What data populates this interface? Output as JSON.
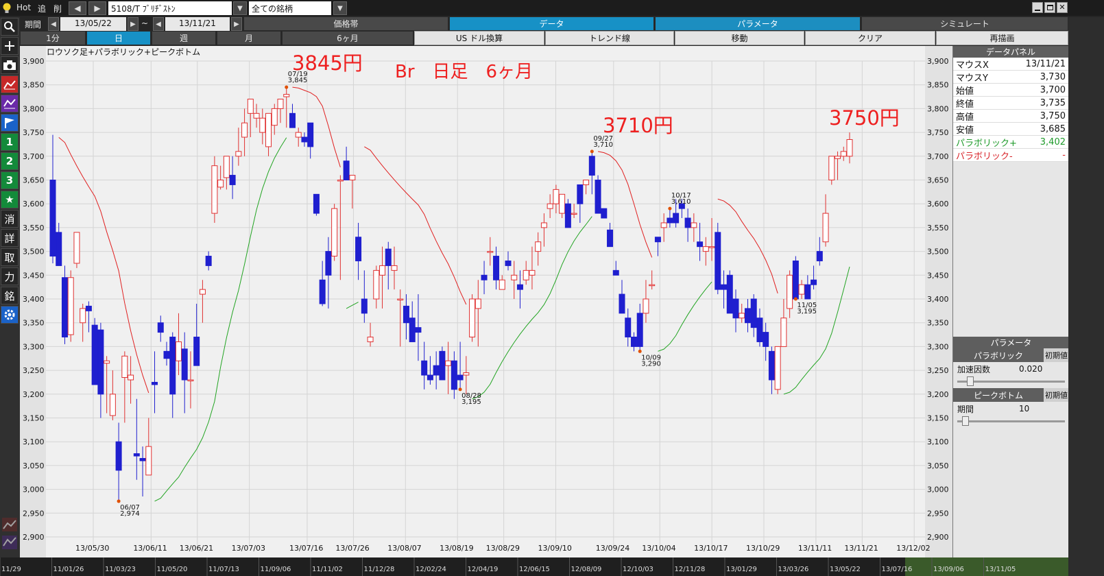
{
  "toolbar": {
    "hot": "Hot",
    "add": "追",
    "del": "削",
    "prev": "◀",
    "next": "▶",
    "symbol": "5108/T ﾌﾞﾘﾁﾞｽﾄﾝ",
    "dd": "▼",
    "group": "全ての銘柄"
  },
  "row2": {
    "period_label": "期間",
    "from": "13/05/22",
    "tilde": "~",
    "to": "13/11/21",
    "tabs": [
      "価格帯",
      "データ",
      "パラメータ",
      "シミュレート"
    ]
  },
  "row3": {
    "intervals": [
      "1分",
      "日",
      "週",
      "月",
      "6ヶ月"
    ],
    "tools": [
      "US ドル換算",
      "トレンド線",
      "移動",
      "クリア",
      "再描画"
    ]
  },
  "sidebar": {
    "g1": "1",
    "g2": "2",
    "g3": "3",
    "star": "★",
    "k1": "消",
    "k2": "詳",
    "k3": "取",
    "k4": "力",
    "k5": "銘"
  },
  "chart_data": {
    "type": "candlestick",
    "title": "ロウソク足+パラボリック+ピークボトム",
    "annotations": {
      "a1": "3845円",
      "a2": "Br　日足　6ヶ月",
      "a3": "3710円",
      "a4": "3750円"
    },
    "ylim": [
      2900,
      3900
    ],
    "y_ticks": [
      "3,900",
      "3,850",
      "3,800",
      "3,750",
      "3,700",
      "3,650",
      "3,600",
      "3,550",
      "3,500",
      "3,450",
      "3,400",
      "3,350",
      "3,300",
      "3,250",
      "3,200",
      "3,150",
      "3,100",
      "3,050",
      "3,000",
      "2,950",
      "2,900"
    ],
    "x_ticks": [
      "13/05/30",
      "13/06/11",
      "13/06/21",
      "13/07/03",
      "13/07/16",
      "13/07/26",
      "13/08/07",
      "13/08/19",
      "13/08/29",
      "13/09/10",
      "13/09/24",
      "13/10/04",
      "13/10/17",
      "13/10/29",
      "13/11/11",
      "13/11/21",
      "13/12/02"
    ],
    "peaks": [
      {
        "date": "07/19",
        "value": "3,845"
      },
      {
        "date": "06/07",
        "value": "2,974"
      },
      {
        "date": "08/28",
        "value": "3,195"
      },
      {
        "date": "09/27",
        "value": "3,710"
      },
      {
        "date": "10/09",
        "value": "3,290"
      },
      {
        "date": "10/17",
        "value": "3,610"
      },
      {
        "date": "11/05",
        "value": "3,195"
      }
    ],
    "candles": [
      [
        3650,
        3745,
        3475,
        3490
      ],
      [
        3540,
        3560,
        3470,
        3470
      ],
      [
        3445,
        3470,
        3305,
        3320
      ],
      [
        3325,
        3460,
        3310,
        3445
      ],
      [
        3475,
        3530,
        3465,
        3540
      ],
      [
        3350,
        3390,
        3310,
        3380
      ],
      [
        3385,
        3395,
        3330,
        3375
      ],
      [
        3345,
        3360,
        3220,
        3220
      ],
      [
        3335,
        3350,
        3150,
        3200
      ],
      [
        3265,
        3280,
        3160,
        3270
      ],
      [
        3155,
        3250,
        3145,
        3200
      ],
      [
        3100,
        3140,
        2975,
        3040
      ],
      [
        3235,
        3290,
        3140,
        3280
      ],
      [
        3230,
        3280,
        3180,
        3240
      ],
      [
        3075,
        3190,
        3020,
        3070
      ],
      [
        3065,
        3090,
        2985,
        3060
      ],
      [
        3030,
        3150,
        3030,
        3090
      ],
      [
        3225,
        3290,
        3160,
        3220
      ],
      [
        3350,
        3365,
        3310,
        3330
      ],
      [
        3290,
        3310,
        3260,
        3275
      ],
      [
        3320,
        3330,
        3150,
        3200
      ],
      [
        3270,
        3370,
        3240,
        3310
      ],
      [
        3295,
        3330,
        3160,
        3230
      ],
      [
        3230,
        3290,
        3170,
        3230
      ],
      [
        3320,
        3390,
        3300,
        3260
      ],
      [
        3410,
        3440,
        3350,
        3420
      ],
      [
        3490,
        3500,
        3460,
        3470
      ],
      [
        3580,
        3700,
        3560,
        3680
      ],
      [
        3635,
        3680,
        3630,
        3650
      ],
      [
        3655,
        3695,
        3630,
        3700
      ],
      [
        3660,
        3700,
        3610,
        3640
      ],
      [
        3700,
        3760,
        3680,
        3710
      ],
      [
        3740,
        3800,
        3700,
        3770
      ],
      [
        3790,
        3810,
        3740,
        3820
      ],
      [
        3780,
        3810,
        3760,
        3790
      ],
      [
        3750,
        3800,
        3725,
        3780
      ],
      [
        3720,
        3790,
        3700,
        3790
      ],
      [
        3765,
        3810,
        3745,
        3800
      ],
      [
        3800,
        3820,
        3770,
        3820
      ],
      [
        3825,
        3845,
        3760,
        3830
      ],
      [
        3790,
        3810,
        3760,
        3760
      ],
      [
        3740,
        3760,
        3720,
        3750
      ],
      [
        3740,
        3750,
        3720,
        3730
      ],
      [
        3770,
        3760,
        3695,
        3720
      ],
      [
        3620,
        3610,
        3575,
        3580
      ],
      [
        3440,
        3480,
        3385,
        3390
      ],
      [
        3500,
        3530,
        3380,
        3450
      ],
      [
        3490,
        3600,
        3480,
        3590
      ],
      [
        3650,
        3660,
        3440,
        3650
      ],
      [
        3690,
        3720,
        3650,
        3650
      ],
      [
        3650,
        3660,
        3590,
        3660
      ],
      [
        3530,
        3560,
        3440,
        3480
      ],
      [
        3400,
        3460,
        3350,
        3370
      ],
      [
        3310,
        3350,
        3300,
        3320
      ],
      [
        3400,
        3470,
        3380,
        3460
      ],
      [
        3450,
        3510,
        3380,
        3470
      ],
      [
        3505,
        3520,
        3420,
        3470
      ],
      [
        3460,
        3510,
        3420,
        3470
      ],
      [
        3400,
        3420,
        3300,
        3400
      ],
      [
        3385,
        3410,
        3315,
        3350
      ],
      [
        3360,
        3395,
        3310,
        3310
      ],
      [
        3340,
        3410,
        3270,
        3330
      ],
      [
        3270,
        3310,
        3210,
        3240
      ],
      [
        3240,
        3280,
        3220,
        3230
      ],
      [
        3260,
        3290,
        3210,
        3240
      ],
      [
        3290,
        3300,
        3250,
        3230
      ],
      [
        3260,
        3310,
        3200,
        3270
      ],
      [
        3270,
        3290,
        3190,
        3210
      ],
      [
        3240,
        3310,
        3210,
        3230
      ],
      [
        3240,
        3280,
        3200,
        3245
      ],
      [
        3320,
        3410,
        3310,
        3400
      ],
      [
        3380,
        3440,
        3300,
        3400
      ],
      [
        3450,
        3480,
        3410,
        3440
      ],
      [
        3500,
        3530,
        3470,
        3500
      ],
      [
        3490,
        3510,
        3420,
        3440
      ],
      [
        3420,
        3450,
        3420,
        3440
      ],
      [
        3480,
        3500,
        3460,
        3470
      ],
      [
        3440,
        3480,
        3400,
        3450
      ],
      [
        3430,
        3460,
        3380,
        3420
      ],
      [
        3440,
        3480,
        3430,
        3460
      ],
      [
        3450,
        3510,
        3420,
        3460
      ],
      [
        3500,
        3540,
        3470,
        3520
      ],
      [
        3550,
        3580,
        3510,
        3560
      ],
      [
        3590,
        3620,
        3570,
        3600
      ],
      [
        3600,
        3640,
        3580,
        3630
      ],
      [
        3580,
        3610,
        3570,
        3620
      ],
      [
        3600,
        3610,
        3550,
        3550
      ],
      [
        3580,
        3600,
        3570,
        3580
      ],
      [
        3640,
        3620,
        3560,
        3600
      ],
      [
        3640,
        3650,
        3620,
        3650
      ],
      [
        3700,
        3710,
        3620,
        3660
      ],
      [
        3650,
        3660,
        3580,
        3580
      ],
      [
        3590,
        3590,
        3570,
        3570
      ],
      [
        3545,
        3560,
        3510,
        3510
      ],
      [
        3460,
        3480,
        3450,
        3450
      ],
      [
        3410,
        3440,
        3370,
        3370
      ],
      [
        3360,
        3380,
        3300,
        3320
      ],
      [
        3320,
        3330,
        3290,
        3300
      ],
      [
        3370,
        3390,
        3290,
        3300
      ],
      [
        3370,
        3440,
        3350,
        3400
      ],
      [
        3430,
        3460,
        3420,
        3430
      ],
      [
        3530,
        3520,
        3490,
        3520
      ],
      [
        3550,
        3580,
        3520,
        3560
      ],
      [
        3570,
        3590,
        3550,
        3560
      ],
      [
        3580,
        3610,
        3550,
        3560
      ],
      [
        3600,
        3610,
        3570,
        3590
      ],
      [
        3570,
        3590,
        3520,
        3550
      ],
      [
        3550,
        3580,
        3520,
        3560
      ],
      [
        3520,
        3560,
        3480,
        3510
      ],
      [
        3500,
        3530,
        3470,
        3510
      ],
      [
        3510,
        3570,
        3480,
        3510
      ],
      [
        3540,
        3560,
        3410,
        3420
      ],
      [
        3430,
        3460,
        3380,
        3420
      ],
      [
        3450,
        3460,
        3370,
        3370
      ],
      [
        3400,
        3420,
        3330,
        3360
      ],
      [
        3360,
        3390,
        3350,
        3370
      ],
      [
        3380,
        3400,
        3330,
        3350
      ],
      [
        3400,
        3410,
        3320,
        3340
      ],
      [
        3360,
        3380,
        3300,
        3310
      ],
      [
        3330,
        3350,
        3270,
        3300
      ],
      [
        3290,
        3300,
        3200,
        3230
      ],
      [
        3210,
        3290,
        3200,
        3300
      ],
      [
        3300,
        3400,
        3300,
        3360
      ],
      [
        3380,
        3460,
        3360,
        3450
      ],
      [
        3480,
        3490,
        3400,
        3400
      ],
      [
        3410,
        3440,
        3400,
        3430
      ],
      [
        3430,
        3450,
        3400,
        3400
      ],
      [
        3440,
        3470,
        3420,
        3430
      ],
      [
        3500,
        3530,
        3470,
        3480
      ],
      [
        3520,
        3620,
        3510,
        3580
      ],
      [
        3650,
        3700,
        3640,
        3700
      ],
      [
        3695,
        3710,
        3650,
        3700
      ],
      [
        3700,
        3720,
        3690,
        3710
      ],
      [
        3700,
        3750,
        3685,
        3735
      ]
    ]
  },
  "panel": {
    "data_title": "データパネル",
    "rows": [
      {
        "label": "マウスX",
        "value": "13/11/21"
      },
      {
        "label": "マウスY",
        "value": "3,730"
      },
      {
        "label": "始値",
        "value": "3,700"
      },
      {
        "label": "終値",
        "value": "3,735"
      },
      {
        "label": "高値",
        "value": "3,750"
      },
      {
        "label": "安値",
        "value": "3,685"
      }
    ],
    "par_plus_label": "パラボリック+",
    "par_plus_value": "3,402",
    "par_minus_label": "パラボリック-",
    "par_minus_value": "-",
    "param_title": "パラメータ",
    "p1_title": "パラボリック",
    "p1_reset": "初期値",
    "p1_name": "加速因数",
    "p1_value": "0.020",
    "p1_level": 0.1,
    "p2_title": "ピークボトム",
    "p2_reset": "初期値",
    "p2_name": "期間",
    "p2_value": "10",
    "p2_level": 0.05
  },
  "bottom_axis": [
    "11/29",
    "11/01/26",
    "11/03/23",
    "11/05/20",
    "11/07/13",
    "11/09/06",
    "11/11/02",
    "11/12/28",
    "12/02/24",
    "12/04/19",
    "12/06/15",
    "12/08/09",
    "12/10/03",
    "12/11/28",
    "13/01/29",
    "13/03/26",
    "13/05/22",
    "13/07/16",
    "13/09/06",
    "13/11/05"
  ],
  "colors": {
    "up": "#e03030",
    "down": "#1f1fcf",
    "sar_down": "#e02020",
    "sar_up": "#22a422",
    "annotation": "#ee2020",
    "peak": "#e05000",
    "active_tab": "#1791c6"
  }
}
